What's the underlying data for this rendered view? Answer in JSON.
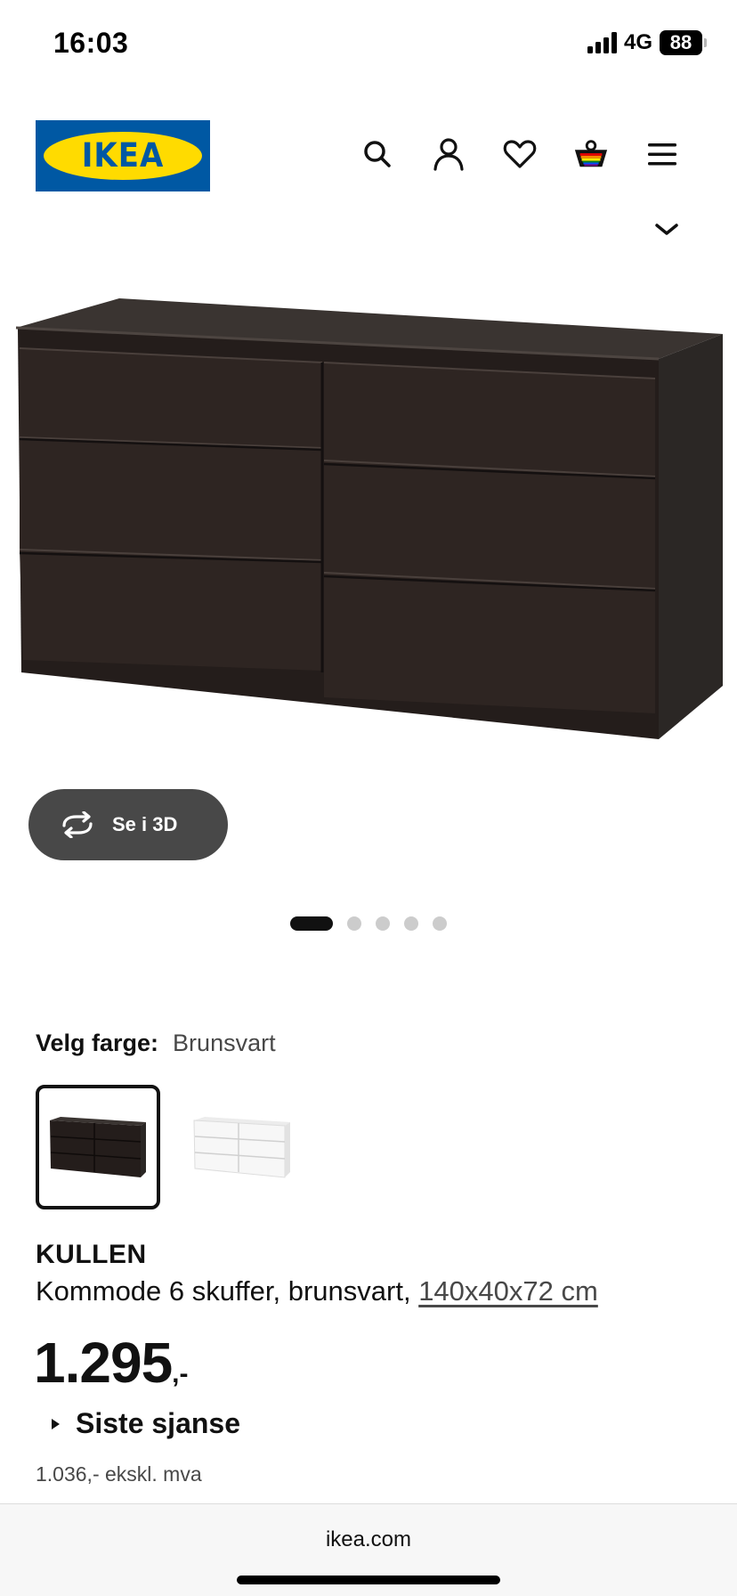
{
  "status_bar": {
    "time": "16:03",
    "network": "4G",
    "battery": "88"
  },
  "header": {
    "logo_text": "IKEA",
    "icons": [
      "search-icon",
      "profile-icon",
      "heart-icon",
      "basket-icon",
      "menu-icon"
    ],
    "brand_colors": {
      "blue": "#0058a3",
      "yellow": "#ffdb00"
    }
  },
  "gallery": {
    "view_3d_label": "Se i 3D",
    "image_count": 5,
    "active_index": 0
  },
  "color_picker": {
    "label": "Velg farge:",
    "selected": "Brunsvart",
    "swatches": [
      "brunsvart",
      "hvit"
    ]
  },
  "product": {
    "name": "KULLEN",
    "description": "Kommode 6 skuffer, brunsvart, ",
    "dimensions": "140x40x72 cm",
    "price": "1.295",
    "price_suffix": ",-",
    "badge": "Siste sjanse",
    "price_ex_vat": "1.036,- ekskl. mva"
  },
  "browser": {
    "domain": "ikea.com"
  }
}
